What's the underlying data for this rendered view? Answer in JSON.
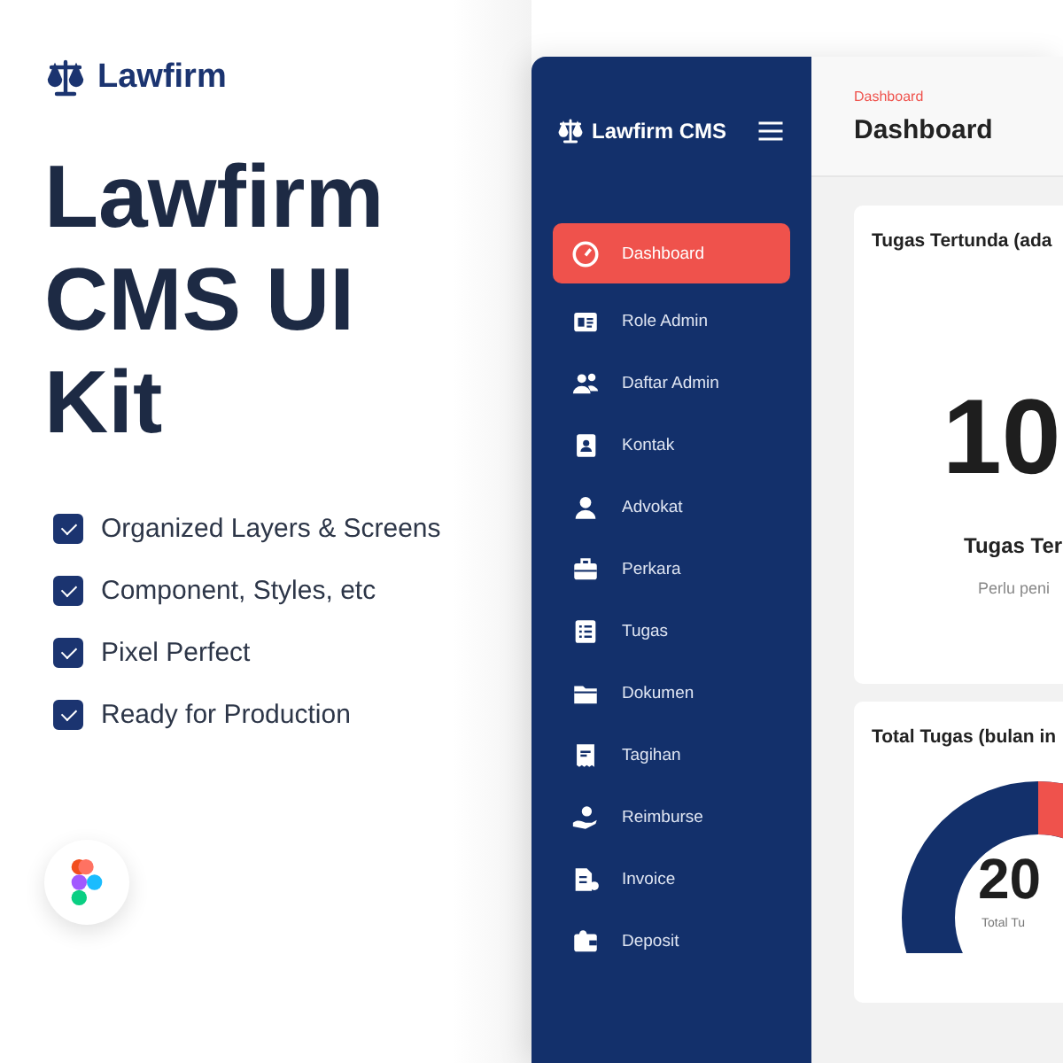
{
  "brand": {
    "name": "Lawfirm"
  },
  "headline": "Lawfirm CMS UI Kit",
  "features": [
    {
      "label": "Organized Layers & Screens",
      "checked": true
    },
    {
      "label": "Component, Styles, etc",
      "checked": true
    },
    {
      "label": "Pixel Perfect",
      "checked": true
    },
    {
      "label": "Ready for Production",
      "checked": true
    }
  ],
  "app": {
    "sidebar": {
      "title": "Lawfirm CMS",
      "items": [
        {
          "label": "Dashboard",
          "selected": true
        },
        {
          "label": "Role Admin",
          "selected": false
        },
        {
          "label": "Daftar Admin",
          "selected": false
        },
        {
          "label": "Kontak",
          "selected": false
        },
        {
          "label": "Advokat",
          "selected": false
        },
        {
          "label": "Perkara",
          "selected": false
        },
        {
          "label": "Tugas",
          "selected": false
        },
        {
          "label": "Dokumen",
          "selected": false
        },
        {
          "label": "Tagihan",
          "selected": false
        },
        {
          "label": "Reimburse",
          "selected": false
        },
        {
          "label": "Invoice",
          "selected": false
        },
        {
          "label": "Deposit",
          "selected": false
        }
      ]
    },
    "breadcrumb": "Dashboard",
    "page_title": "Dashboard",
    "cards": [
      {
        "kind": "stat",
        "title": "Tugas Tertunda (ada",
        "value": "10",
        "label": "Tugas Ter",
        "note": "Perlu peni"
      },
      {
        "kind": "donut",
        "title": "Total Tugas (bulan in",
        "value": "20",
        "label": "Total Tu"
      }
    ]
  }
}
